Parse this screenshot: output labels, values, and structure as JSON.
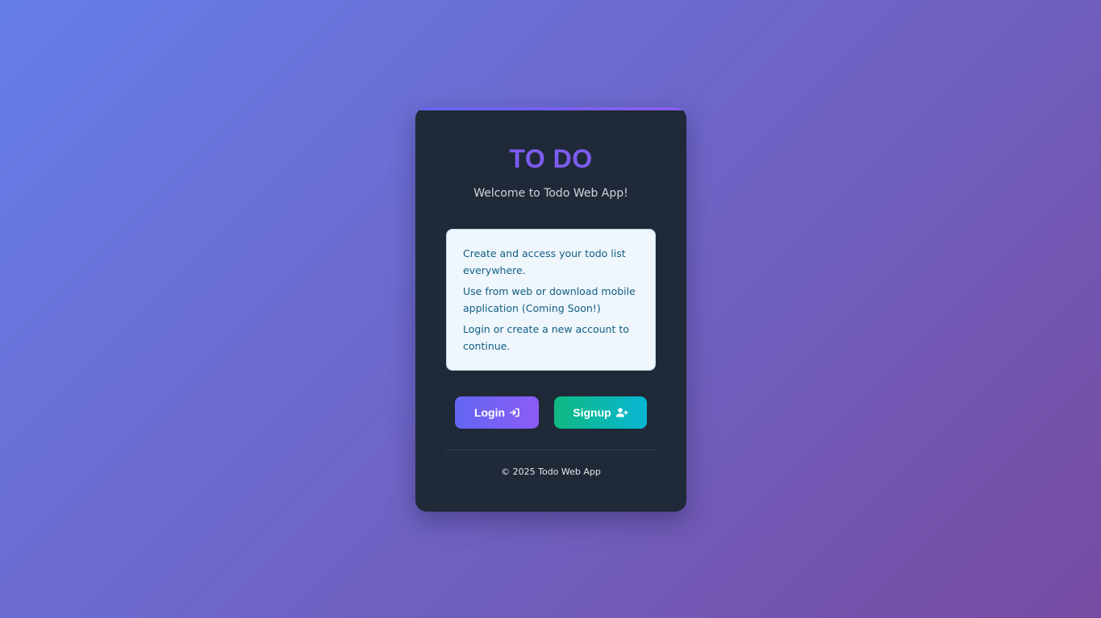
{
  "card": {
    "title": "TO DO",
    "subtitle": "Welcome to Todo Web App!"
  },
  "info": {
    "lines": [
      "Create and access your todo list everywhere.",
      "Use from web or download mobile application (Coming Soon!)",
      "Login or create a new account to continue."
    ]
  },
  "actions": {
    "login_label": "Login",
    "login_icon": "sign-in-icon",
    "signup_label": "Signup",
    "signup_icon": "user-plus-icon"
  },
  "footer": {
    "text": "© 2025 Todo Web App"
  },
  "colors": {
    "background_start": "#667eea",
    "background_end": "#764ba2",
    "card": "#1f2937",
    "title": "#7c5cf0",
    "login_start": "#6366f1",
    "login_end": "#8b5cf6",
    "signup_start": "#10b981",
    "signup_end": "#06b6d4",
    "info_bg": "#eff6fc",
    "info_text": "#0f5f84"
  }
}
